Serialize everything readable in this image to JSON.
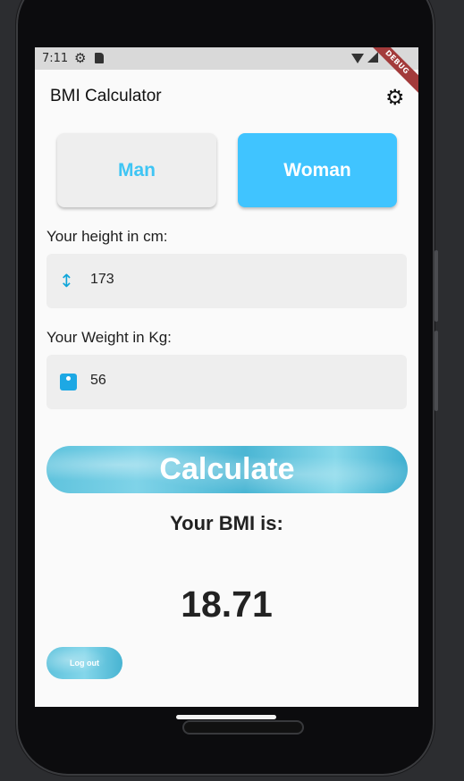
{
  "status_bar": {
    "time": "7:11",
    "debug_label": "DEBUG"
  },
  "app_bar": {
    "title": "BMI Calculator",
    "settings_icon": "gear-icon"
  },
  "gender": {
    "man_label": "Man",
    "woman_label": "Woman",
    "selected": "Woman"
  },
  "height": {
    "label": "Your height in cm:",
    "value": "173",
    "icon": "height-arrows-icon"
  },
  "weight": {
    "label": "Your Weight in Kg:",
    "value": "56",
    "icon": "scale-icon"
  },
  "calculate_label": "Calculate",
  "result": {
    "heading": "Your BMI is:",
    "value": "18.71"
  },
  "logout_label": "Log out",
  "colors": {
    "accent": "#40c4ff",
    "man_text": "#3fc5f4",
    "field_bg": "#eeeeee"
  }
}
